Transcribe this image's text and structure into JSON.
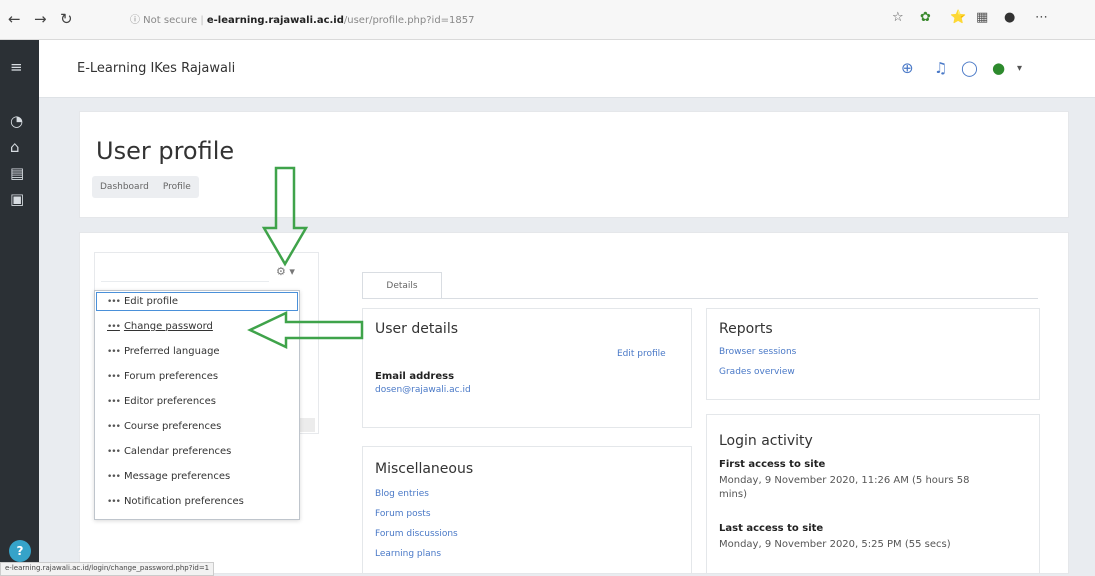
{
  "browser": {
    "back": "←",
    "forward": "→",
    "reload": "↻",
    "security": "ⓘ Not secure",
    "domain": "e-learning.rajawali.ac.id",
    "path": "/user/profile.php?id=1857"
  },
  "site": {
    "name": "E-Learning IKes Rajawali"
  },
  "header": {
    "title": "User profile",
    "breadcrumbs": [
      "Dashboard",
      "Profile"
    ]
  },
  "user_menu": {
    "items": [
      "Edit profile",
      "Change password",
      "Preferred language",
      "Forum preferences",
      "Editor preferences",
      "Course preferences",
      "Calendar preferences",
      "Message preferences",
      "Notification preferences"
    ],
    "dots": "•••"
  },
  "tabs": {
    "details": "Details"
  },
  "user_details": {
    "title": "User details",
    "edit_link": "Edit profile",
    "email_label": "Email address",
    "email_value": "dosen@rajawali.ac.id"
  },
  "reports": {
    "title": "Reports",
    "links": [
      "Browser sessions",
      "Grades overview"
    ]
  },
  "misc": {
    "title": "Miscellaneous",
    "links": [
      "Blog entries",
      "Forum posts",
      "Forum discussions",
      "Learning plans"
    ]
  },
  "login": {
    "title": "Login activity",
    "first_label": "First access to site",
    "first_value": "Monday, 9 November 2020, 11:26 AM  (5 hours 58",
    "first_value2": "mins)",
    "last_label": "Last access to site",
    "last_value": "Monday, 9 November 2020, 5:25 PM  (55 secs)"
  },
  "statusbar": {
    "url": "e-learning.rajawali.ac.id/login/change_password.php?id=1"
  },
  "colors": {
    "drawer": "#2b3035",
    "accent_link": "#4a79c7",
    "arrow": "#3fa34a"
  }
}
